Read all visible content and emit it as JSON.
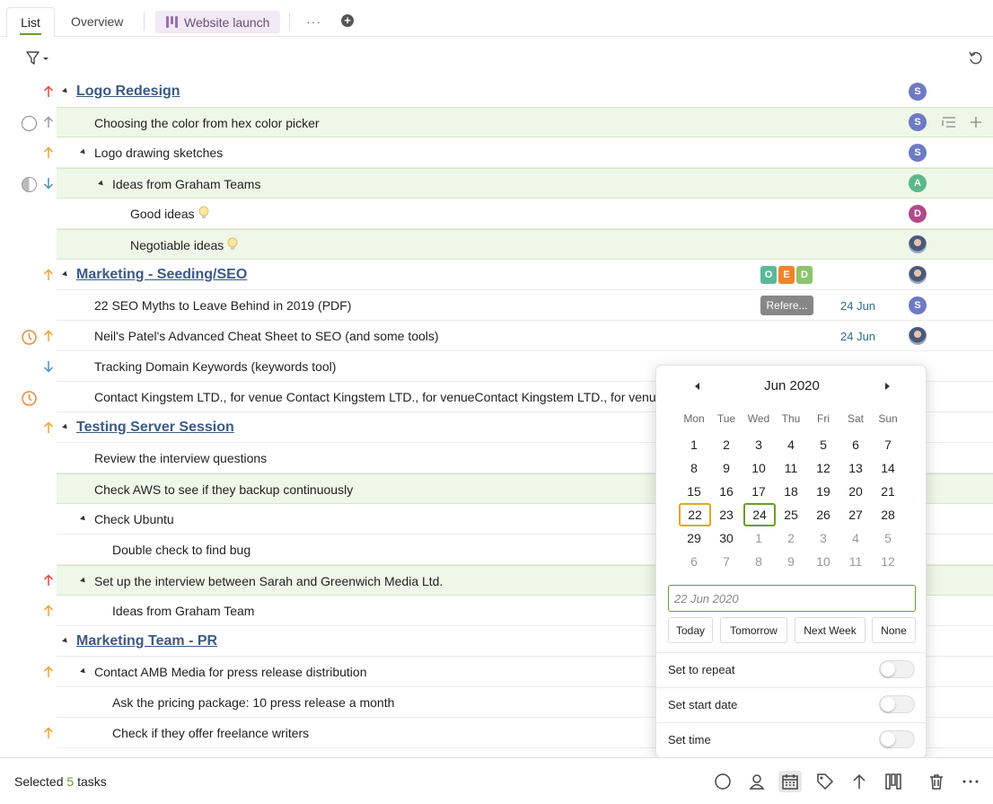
{
  "tabs": {
    "list": "List",
    "overview": "Overview",
    "project": "Website launch",
    "more": "···"
  },
  "colors": {
    "accent": "#6b9c2c",
    "project_link": "#3b5a86",
    "highlight_row": "#eff7e8",
    "priority_high": "#e0473f",
    "priority_medium": "#f0a030",
    "priority_low": "#4a8fb5"
  },
  "rows": [
    {
      "title": "Logo Redesign",
      "avatar": "S"
    },
    {
      "title": "Choosing the color from hex color picker",
      "avatar": "S"
    },
    {
      "title": "Logo drawing sketches",
      "avatar": "S"
    },
    {
      "title": "Ideas from Graham Teams",
      "avatar": "A"
    },
    {
      "title": "Good ideas",
      "avatar": "D"
    },
    {
      "title": "Negotiable ideas",
      "avatar": ""
    },
    {
      "title": "Marketing - Seeding/SEO",
      "avatar": "",
      "tags": [
        "O",
        "E",
        "D"
      ]
    },
    {
      "title": "22 SEO Myths to Leave Behind in 2019 (PDF)",
      "avatar": "S",
      "chip": "Refere...",
      "date": "24 Jun"
    },
    {
      "title": "Neil's Patel's Advanced Cheat Sheet to SEO (and some tools)",
      "avatar": "",
      "date": "24 Jun"
    },
    {
      "title": "Tracking Domain Keywords (keywords tool)"
    },
    {
      "title": "Contact Kingstem LTD., for venue Contact Kingstem LTD., for venueContact Kingstem LTD., for venue"
    },
    {
      "title": "Testing Server Session"
    },
    {
      "title": "Review the interview questions"
    },
    {
      "title": "Check AWS to see if they backup continuously"
    },
    {
      "title": "Check Ubuntu"
    },
    {
      "title": "Double check to find bug"
    },
    {
      "title": "Set up the interview between Sarah and Greenwich Media Ltd."
    },
    {
      "title": "Ideas from Graham Team"
    },
    {
      "title": "Marketing Team - PR"
    },
    {
      "title": "Contact AMB Media for press release distribution"
    },
    {
      "title": "Ask the pricing package: 10 press release a month"
    },
    {
      "title": "Check if they offer freelance writers"
    }
  ],
  "picker": {
    "month": "Jun 2020",
    "weekdays": [
      "Mon",
      "Tue",
      "Wed",
      "Thu",
      "Fri",
      "Sat",
      "Sun"
    ],
    "weeks": [
      [
        "1",
        "2",
        "3",
        "4",
        "5",
        "6",
        "7"
      ],
      [
        "8",
        "9",
        "10",
        "11",
        "12",
        "13",
        "14"
      ],
      [
        "15",
        "16",
        "17",
        "18",
        "19",
        "20",
        "21"
      ],
      [
        "22",
        "23",
        "24",
        "25",
        "26",
        "27",
        "28"
      ],
      [
        "29",
        "30",
        "1",
        "2",
        "3",
        "4",
        "5"
      ],
      [
        "6",
        "7",
        "8",
        "9",
        "10",
        "11",
        "12"
      ]
    ],
    "input_placeholder": "22 Jun 2020",
    "buttons": [
      "Today",
      "Tomorrow",
      "Next Week",
      "None"
    ],
    "options": [
      "Set to repeat",
      "Set start date",
      "Set time"
    ]
  },
  "footer": {
    "selected_prefix": "Selected",
    "selected_count": "5",
    "selected_suffix": "tasks"
  }
}
